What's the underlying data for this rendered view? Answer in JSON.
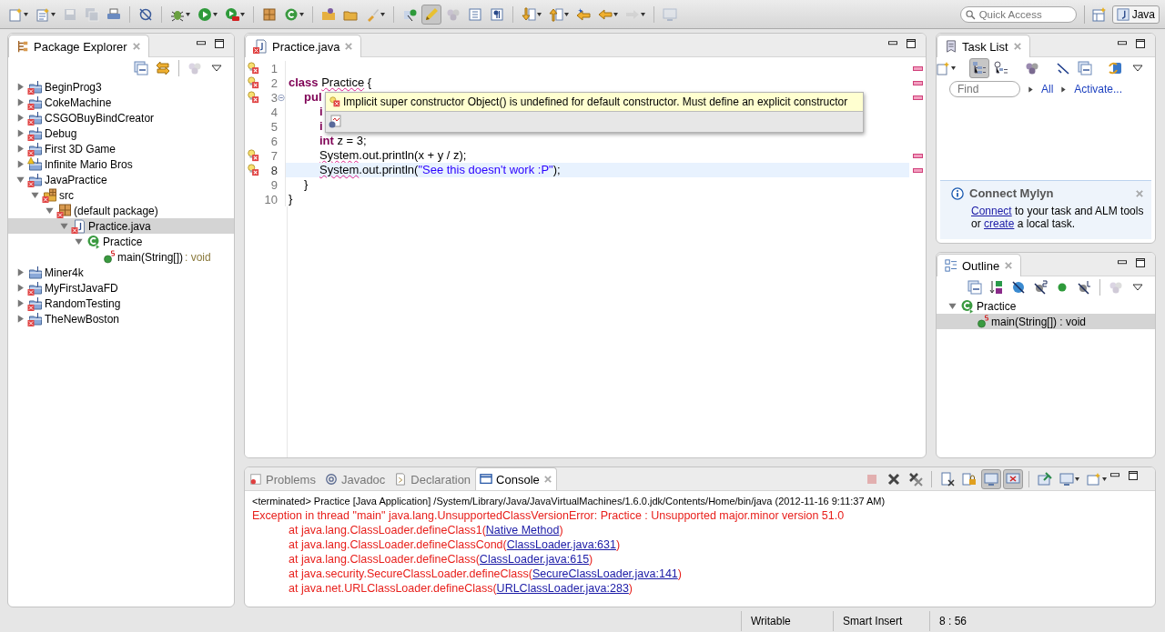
{
  "toolbar": {
    "items": [
      {
        "kind": "new",
        "menu": true,
        "disabled": false,
        "selected": false
      },
      {
        "kind": "new-list",
        "menu": true,
        "disabled": false,
        "selected": false
      },
      {
        "kind": "save",
        "menu": false,
        "disabled": true,
        "selected": false
      },
      {
        "kind": "save-all",
        "menu": false,
        "disabled": true,
        "selected": false
      },
      {
        "kind": "print",
        "menu": false,
        "disabled": false,
        "selected": false
      },
      {
        "kind": "separator"
      },
      {
        "kind": "slash-circle",
        "menu": false,
        "disabled": false,
        "selected": false
      },
      {
        "kind": "separator"
      },
      {
        "kind": "bug",
        "menu": true,
        "disabled": false,
        "selected": false
      },
      {
        "kind": "run",
        "menu": true,
        "disabled": false,
        "selected": false
      },
      {
        "kind": "run-tool",
        "menu": true,
        "disabled": false,
        "selected": false
      },
      {
        "kind": "separator"
      },
      {
        "kind": "package",
        "menu": false,
        "disabled": false,
        "selected": false
      },
      {
        "kind": "class",
        "menu": true,
        "disabled": false,
        "selected": false
      },
      {
        "kind": "separator"
      },
      {
        "kind": "folder-ball",
        "menu": false,
        "disabled": false,
        "selected": false
      },
      {
        "kind": "folder",
        "menu": false,
        "disabled": false,
        "selected": false
      },
      {
        "kind": "brush",
        "menu": true,
        "disabled": false,
        "selected": false
      },
      {
        "kind": "separator"
      },
      {
        "kind": "open-type",
        "menu": false,
        "disabled": false,
        "selected": false
      },
      {
        "kind": "highlighter",
        "menu": false,
        "disabled": false,
        "selected": true
      },
      {
        "kind": "nodes",
        "menu": false,
        "disabled": true,
        "selected": false
      },
      {
        "kind": "block",
        "menu": false,
        "disabled": false,
        "selected": false
      },
      {
        "kind": "pilcrow",
        "menu": false,
        "disabled": false,
        "selected": false
      },
      {
        "kind": "separator"
      },
      {
        "kind": "arrow-down",
        "menu": true,
        "disabled": false,
        "selected": false
      },
      {
        "kind": "arrow-up",
        "menu": true,
        "disabled": false,
        "selected": false
      },
      {
        "kind": "arrow-left-star",
        "menu": false,
        "disabled": false,
        "selected": false
      },
      {
        "kind": "arrow-left",
        "menu": true,
        "disabled": false,
        "selected": false
      },
      {
        "kind": "arrow-right",
        "menu": true,
        "disabled": true,
        "selected": false
      },
      {
        "kind": "separator"
      },
      {
        "kind": "monitor",
        "menu": false,
        "disabled": true,
        "selected": false
      }
    ],
    "quick_access": {
      "placeholder": "Quick Access"
    },
    "perspective": {
      "label": "Java",
      "selected": true
    }
  },
  "package_explorer": {
    "title": "Package Explorer",
    "toolbar": [
      {
        "kind": "collapse-all",
        "menu": false,
        "disabled": false,
        "selected": false
      },
      {
        "kind": "link",
        "menu": false,
        "disabled": false,
        "selected": false
      },
      {
        "kind": "separator"
      },
      {
        "kind": "nodes",
        "menu": false,
        "disabled": true,
        "selected": false
      },
      {
        "kind": "view-menu",
        "menu": false,
        "disabled": false,
        "selected": false
      }
    ],
    "tree": [
      {
        "label": "BeginProg3",
        "kind": "project",
        "error": true,
        "warning": false,
        "expanded": false,
        "selected": false
      },
      {
        "label": "CokeMachine",
        "kind": "project",
        "error": true,
        "warning": false,
        "expanded": false,
        "selected": false
      },
      {
        "label": "CSGOBuyBindCreator",
        "kind": "project",
        "error": true,
        "warning": false,
        "expanded": false,
        "selected": false
      },
      {
        "label": "Debug",
        "kind": "project",
        "error": true,
        "warning": false,
        "expanded": false,
        "selected": false
      },
      {
        "label": "First 3D Game",
        "kind": "project",
        "error": true,
        "warning": false,
        "expanded": false,
        "selected": false
      },
      {
        "label": "Infinite Mario Bros",
        "kind": "project",
        "error": false,
        "warning": true,
        "expanded": false,
        "selected": false
      },
      {
        "label": "JavaPractice",
        "kind": "project",
        "error": true,
        "warning": false,
        "expanded": true,
        "selected": false,
        "children": [
          {
            "label": "src",
            "kind": "folder",
            "error": true,
            "expanded": true,
            "selected": false,
            "children": [
              {
                "label": "(default package)",
                "kind": "package",
                "error": true,
                "expanded": true,
                "selected": false,
                "children": [
                  {
                    "label": "Practice.java",
                    "kind": "file",
                    "error": true,
                    "expanded": true,
                    "selected": true,
                    "children": [
                      {
                        "label": "Practice",
                        "kind": "class",
                        "error": false,
                        "expanded": true,
                        "selected": false,
                        "children": [
                          {
                            "label": "main(String[])",
                            "detail": " : void",
                            "kind": "method",
                            "static": true,
                            "selected": false
                          }
                        ]
                      }
                    ]
                  }
                ]
              }
            ]
          }
        ]
      },
      {
        "label": "Miner4k",
        "kind": "project",
        "error": false,
        "warning": false,
        "expanded": false,
        "selected": false
      },
      {
        "label": "MyFirstJavaFD",
        "kind": "project",
        "error": true,
        "warning": false,
        "expanded": false,
        "selected": false
      },
      {
        "label": "RandomTesting",
        "kind": "project",
        "error": true,
        "warning": false,
        "expanded": false,
        "selected": false
      },
      {
        "label": "TheNewBoston",
        "kind": "project",
        "error": true,
        "warning": false,
        "expanded": false,
        "selected": false
      }
    ]
  },
  "editor": {
    "tab": {
      "title": "Practice.java",
      "error": true
    },
    "lines": [
      {
        "number": "1",
        "error": true,
        "current": false,
        "folding": false
      },
      {
        "number": "2",
        "error": true,
        "current": false,
        "folding": false,
        "tokens": [
          {
            "kind": "keyword",
            "text": "class "
          },
          {
            "kind": "error",
            "text": "Practice"
          },
          {
            "kind": "plain",
            "text": " {"
          }
        ],
        "children": [
          {
            "number": "3",
            "error": true,
            "current": false,
            "folding": true,
            "tokens": [
              {
                "kind": "keyword",
                "text": "pul"
              }
            ],
            "children": [
              {
                "number": "4",
                "error": false,
                "current": false,
                "folding": false,
                "tokens": [
                  {
                    "kind": "keyword",
                    "text": "i"
                  }
                ]
              },
              {
                "number": "5",
                "error": false,
                "current": false,
                "folding": false,
                "tokens": [
                  {
                    "kind": "keyword",
                    "text": "i"
                  }
                ]
              },
              {
                "number": "6",
                "error": false,
                "current": false,
                "folding": false,
                "tokens": [
                  {
                    "kind": "keyword",
                    "text": "int"
                  },
                  {
                    "kind": "plain",
                    "text": " z = 3;"
                  }
                ]
              },
              {
                "number": "7",
                "error": true,
                "current": false,
                "folding": false,
                "tokens": [
                  {
                    "kind": "error",
                    "text": "System"
                  },
                  {
                    "kind": "plain",
                    "text": ".out.println(x + y / z);"
                  }
                ]
              },
              {
                "number": "8",
                "error": true,
                "current": true,
                "folding": false,
                "tokens": [
                  {
                    "kind": "error",
                    "text": "System"
                  },
                  {
                    "kind": "plain",
                    "text": ".out.println("
                  },
                  {
                    "kind": "string",
                    "text": "\"See this doesn't work :P\""
                  },
                  {
                    "kind": "plain",
                    "text": ");"
                  }
                ]
              }
            ]
          },
          {
            "number": "9",
            "error": false,
            "current": false,
            "folding": false,
            "tokens": [
              {
                "kind": "plain",
                "text": "}"
              }
            ]
          }
        ]
      },
      {
        "number": "10",
        "error": false,
        "current": false,
        "folding": false,
        "tokens": [
          {
            "kind": "plain",
            "text": "}"
          }
        ]
      }
    ],
    "hover": {
      "message": "Implicit super constructor Object() is undefined for default constructor. Must define an explicit constructor",
      "error": true
    }
  },
  "task_list": {
    "title": "Task List",
    "toolbar": [
      {
        "kind": "new-task",
        "menu": true,
        "disabled": false,
        "selected": false
      },
      {
        "kind": "separator"
      },
      {
        "kind": "tree",
        "menu": false,
        "disabled": false,
        "selected": true
      },
      {
        "kind": "clock-tree",
        "menu": false,
        "disabled": false,
        "selected": false
      },
      {
        "kind": "separator"
      },
      {
        "kind": "nodes",
        "menu": false,
        "disabled": false,
        "selected": false
      },
      {
        "kind": "separator"
      },
      {
        "kind": "check-slash",
        "menu": false,
        "disabled": false,
        "selected": false
      },
      {
        "kind": "collapse-all",
        "menu": false,
        "disabled": false,
        "selected": false
      },
      {
        "kind": "separator"
      },
      {
        "kind": "sync",
        "menu": false,
        "disabled": false,
        "selected": false
      },
      {
        "kind": "view-menu",
        "menu": false,
        "disabled": false,
        "selected": false
      }
    ],
    "find": {
      "placeholder": "Find"
    },
    "filters": [
      "All",
      "Activate..."
    ],
    "mylyn": {
      "title": "Connect Mylyn",
      "text": [
        {
          "text": "Connect",
          "link": true
        },
        {
          "text": " to your task and ALM tools or ",
          "link": false
        },
        {
          "text": "create",
          "link": true
        },
        {
          "text": " a local task.",
          "link": false
        }
      ]
    }
  },
  "outline": {
    "title": "Outline",
    "toolbar": [
      {
        "kind": "collapse-all",
        "menu": false,
        "disabled": false,
        "selected": false
      },
      {
        "kind": "sort",
        "menu": false,
        "disabled": false,
        "selected": false
      },
      {
        "kind": "circle-slash",
        "menu": false,
        "disabled": false,
        "selected": false
      },
      {
        "kind": "slash-s",
        "menu": false,
        "disabled": false,
        "selected": false
      },
      {
        "kind": "dot",
        "menu": false,
        "disabled": false,
        "selected": false
      },
      {
        "kind": "slash-l",
        "menu": false,
        "disabled": false,
        "selected": false
      },
      {
        "kind": "separator"
      },
      {
        "kind": "nodes",
        "menu": false,
        "disabled": true,
        "selected": false
      },
      {
        "kind": "view-menu",
        "menu": false,
        "disabled": false,
        "selected": false
      }
    ],
    "tree": [
      {
        "label": "Practice",
        "kind": "class",
        "error": false,
        "expanded": true,
        "selected": false,
        "children": [
          {
            "label": "main(String[]) : void",
            "kind": "method",
            "static": true,
            "selected": true
          }
        ]
      }
    ]
  },
  "console_area": {
    "tabs": [
      {
        "label": "Problems",
        "kind": "problems",
        "selected": false
      },
      {
        "label": "Javadoc",
        "kind": "javadoc",
        "selected": false
      },
      {
        "label": "Declaration",
        "kind": "declaration",
        "selected": false
      },
      {
        "label": "Console",
        "kind": "console",
        "selected": true
      }
    ],
    "toolbar": [
      {
        "kind": "stop",
        "menu": false,
        "disabled": true,
        "selected": false
      },
      {
        "kind": "x",
        "menu": false,
        "disabled": false,
        "selected": false
      },
      {
        "kind": "x-x",
        "menu": false,
        "disabled": false,
        "selected": false
      },
      {
        "kind": "separator"
      },
      {
        "kind": "clear",
        "menu": false,
        "disabled": false,
        "selected": false
      },
      {
        "kind": "lock",
        "menu": false,
        "disabled": false,
        "selected": false
      },
      {
        "kind": "monitor",
        "menu": false,
        "disabled": false,
        "selected": true
      },
      {
        "kind": "monitor-error",
        "menu": false,
        "disabled": false,
        "selected": true
      },
      {
        "kind": "separator"
      },
      {
        "kind": "pin",
        "menu": false,
        "disabled": false,
        "selected": false
      },
      {
        "kind": "monitor",
        "menu": true,
        "disabled": false,
        "selected": false
      },
      {
        "kind": "new-console",
        "menu": true,
        "disabled": false,
        "selected": false
      }
    ],
    "header": "<terminated> Practice [Java Application] /System/Library/Java/JavaVirtualMachines/1.6.0.jdk/Contents/Home/bin/java (2012-11-16 9:11:37 AM)",
    "lines": [
      {
        "kind": "exception",
        "text": "Exception in thread \"main\" java.lang.UnsupportedClassVersionError: Practice : Unsupported major.minor version 51.0"
      },
      {
        "kind": "frame",
        "text": "at java.lang.ClassLoader.defineClass1(",
        "link": "Native Method",
        "tail": ")"
      },
      {
        "kind": "frame",
        "text": "at java.lang.ClassLoader.defineClassCond(",
        "link": "ClassLoader.java:631",
        "tail": ")"
      },
      {
        "kind": "frame",
        "text": "at java.lang.ClassLoader.defineClass(",
        "link": "ClassLoader.java:615",
        "tail": ")"
      },
      {
        "kind": "frame",
        "text": "at java.security.SecureClassLoader.defineClass(",
        "link": "SecureClassLoader.java:141",
        "tail": ")"
      },
      {
        "kind": "frame",
        "text": "at java.net.URLClassLoader.defineClass(",
        "link": "URLClassLoader.java:283",
        "tail": ")"
      }
    ]
  },
  "status_bar": [
    "Writable",
    "Smart Insert",
    "8 : 56"
  ]
}
